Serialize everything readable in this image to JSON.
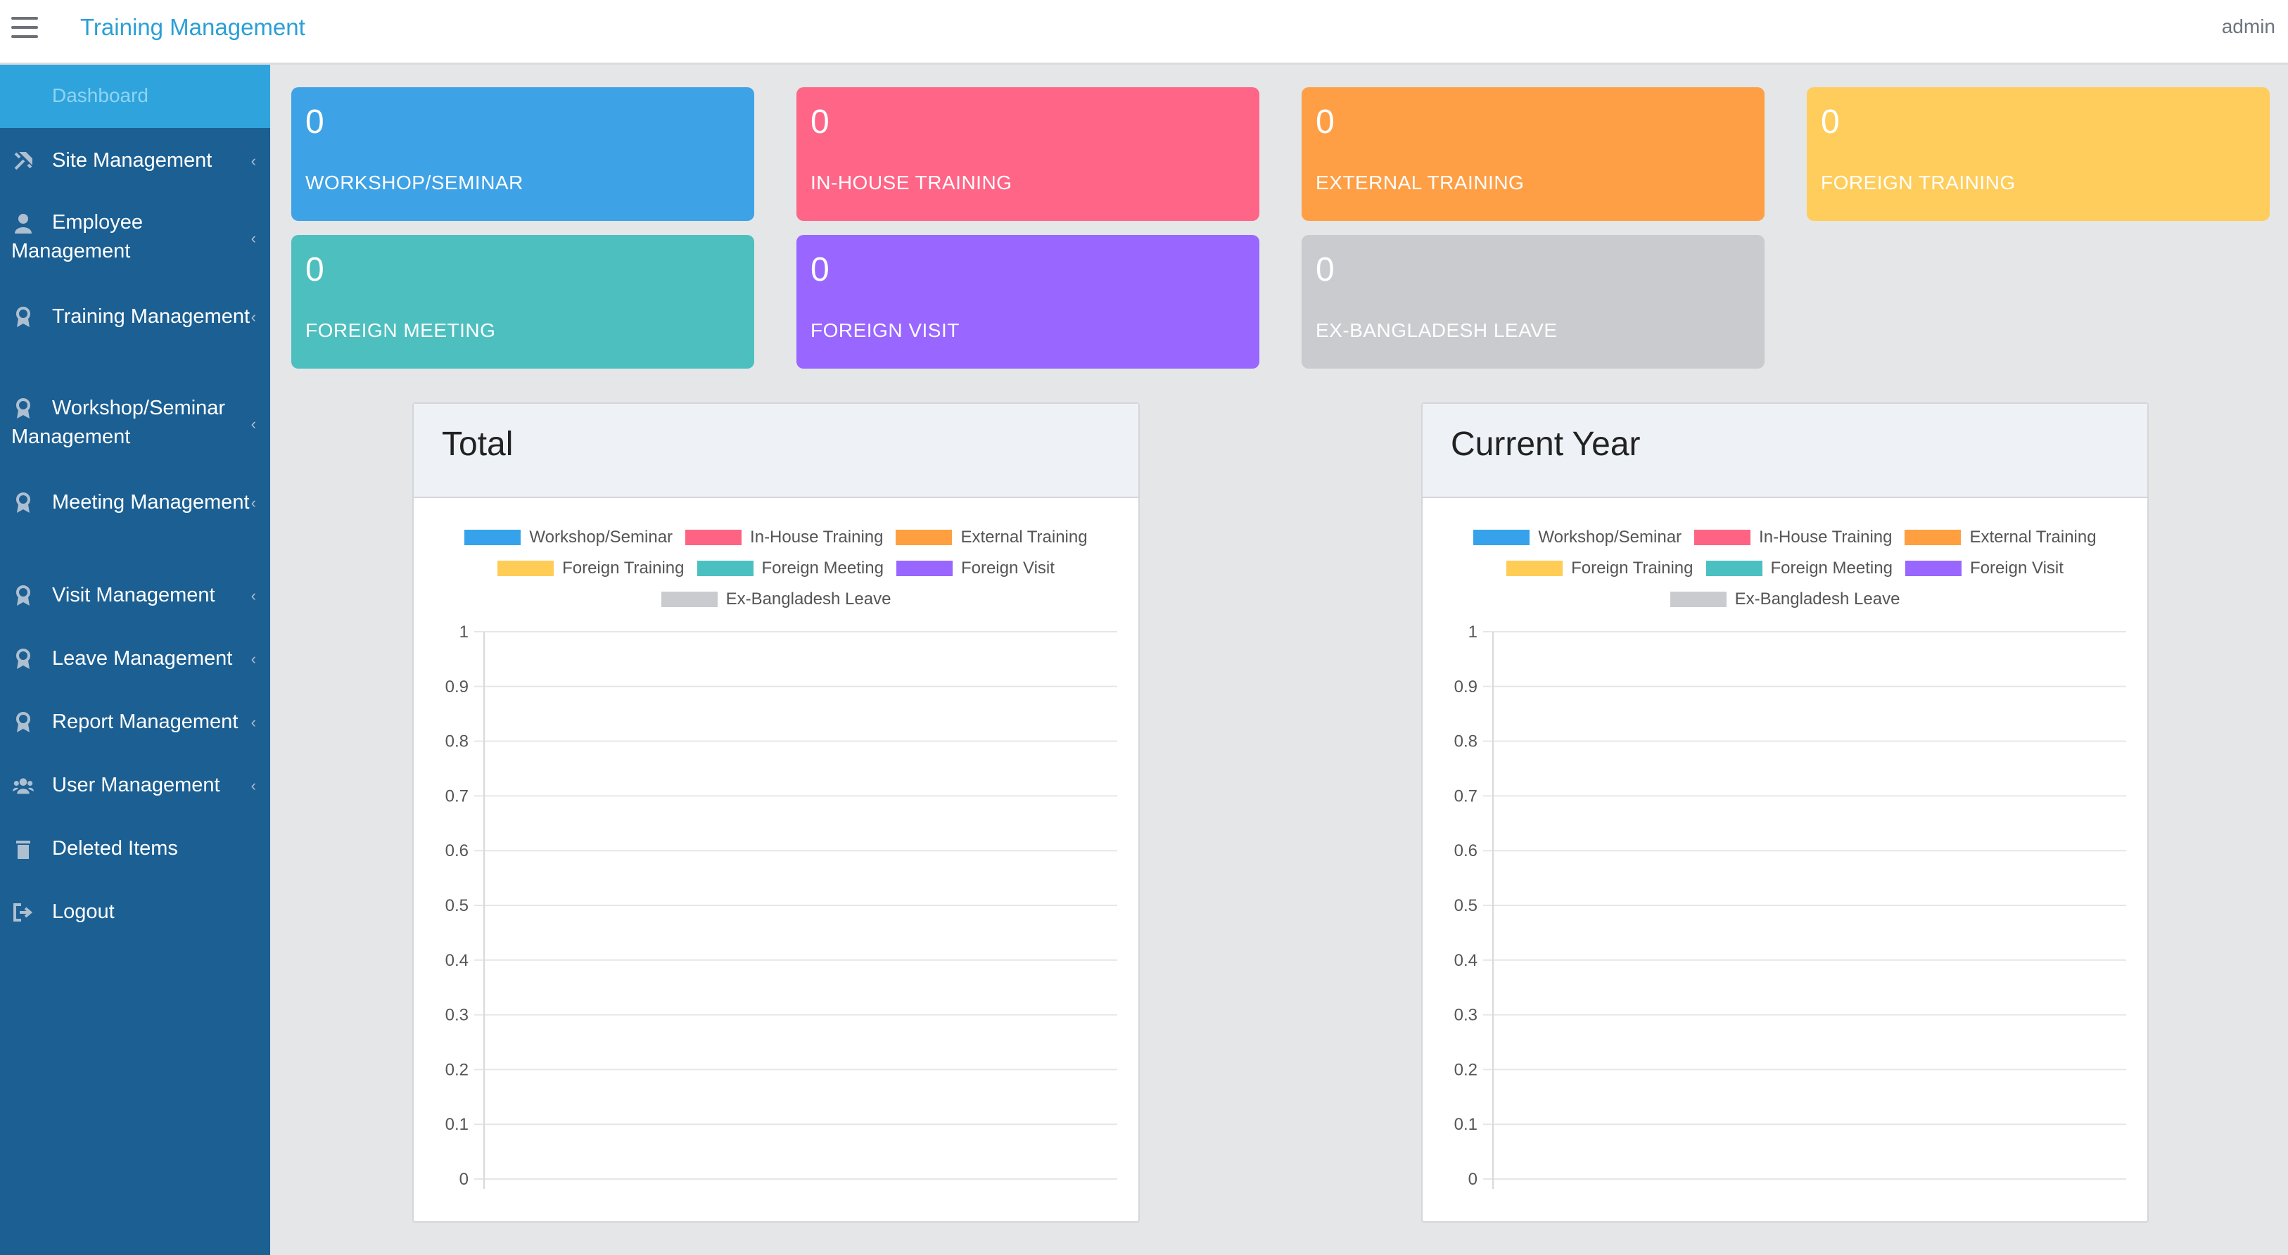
{
  "header": {
    "title": "Training Management",
    "user": "admin"
  },
  "sidebar": {
    "dashboard": "Dashboard",
    "items": [
      {
        "label": "Site Management",
        "icon": "tools-icon"
      },
      {
        "label": "Employee Management",
        "icon": "user-icon"
      },
      {
        "label": "Training Management",
        "icon": "award-icon"
      },
      {
        "label": "Workshop/Seminar Management",
        "icon": "award-icon"
      },
      {
        "label": "Meeting Management",
        "icon": "award-icon"
      },
      {
        "label": "Visit Management",
        "icon": "award-icon"
      },
      {
        "label": "Leave Management",
        "icon": "award-icon"
      },
      {
        "label": "Report Management",
        "icon": "award-icon"
      },
      {
        "label": "User Management",
        "icon": "users-icon"
      },
      {
        "label": "Deleted Items",
        "icon": "trash-icon"
      },
      {
        "label": "Logout",
        "icon": "logout-icon"
      }
    ]
  },
  "cards": [
    {
      "value": "0",
      "label": "WORKSHOP/SEMINAR",
      "color": "#3ea2e6"
    },
    {
      "value": "0",
      "label": "IN-HOUSE TRAINING",
      "color": "#fe6587"
    },
    {
      "value": "0",
      "label": "EXTERNAL TRAINING",
      "color": "#fe9f46"
    },
    {
      "value": "0",
      "label": "FOREIGN TRAINING",
      "color": "#fecd5c"
    },
    {
      "value": "0",
      "label": "FOREIGN MEETING",
      "color": "#4dbfbf"
    },
    {
      "value": "0",
      "label": "FOREIGN VISIT",
      "color": "#9966ff"
    },
    {
      "value": "0",
      "label": "EX-BANGLADESH LEAVE",
      "color": "#c9cbcf"
    }
  ],
  "panels": {
    "total_title": "Total",
    "current_year_title": "Current Year"
  },
  "chart_data": [
    {
      "type": "bar",
      "title": "Total",
      "series": [
        {
          "name": "Workshop/Seminar",
          "values": [
            0
          ],
          "color": "#36a2eb"
        },
        {
          "name": "In-House Training",
          "values": [
            0
          ],
          "color": "#ff6384"
        },
        {
          "name": "External Training",
          "values": [
            0
          ],
          "color": "#ff9f40"
        },
        {
          "name": "Foreign Training",
          "values": [
            0
          ],
          "color": "#ffcd56"
        },
        {
          "name": "Foreign Meeting",
          "values": [
            0
          ],
          "color": "#4bc0c0"
        },
        {
          "name": "Foreign Visit",
          "values": [
            0
          ],
          "color": "#9966ff"
        },
        {
          "name": "Ex-Bangladesh Leave",
          "values": [
            0
          ],
          "color": "#c9cbcf"
        }
      ],
      "yticks": [
        "1",
        "0.9",
        "0.8",
        "0.7",
        "0.6",
        "0.5",
        "0.4",
        "0.3",
        "0.2",
        "0.1",
        "0"
      ],
      "ylim": [
        0,
        1
      ],
      "legend": "top",
      "grid": true
    },
    {
      "type": "bar",
      "title": "Current Year",
      "series": [
        {
          "name": "Workshop/Seminar",
          "values": [
            0
          ],
          "color": "#36a2eb"
        },
        {
          "name": "In-House Training",
          "values": [
            0
          ],
          "color": "#ff6384"
        },
        {
          "name": "External Training",
          "values": [
            0
          ],
          "color": "#ff9f40"
        },
        {
          "name": "Foreign Training",
          "values": [
            0
          ],
          "color": "#ffcd56"
        },
        {
          "name": "Foreign Meeting",
          "values": [
            0
          ],
          "color": "#4bc0c0"
        },
        {
          "name": "Foreign Visit",
          "values": [
            0
          ],
          "color": "#9966ff"
        },
        {
          "name": "Ex-Bangladesh Leave",
          "values": [
            0
          ],
          "color": "#c9cbcf"
        }
      ],
      "yticks": [
        "1",
        "0.9",
        "0.8",
        "0.7",
        "0.6",
        "0.5",
        "0.4",
        "0.3",
        "0.2",
        "0.1",
        "0"
      ],
      "ylim": [
        0,
        1
      ],
      "legend": "top",
      "grid": true
    }
  ]
}
